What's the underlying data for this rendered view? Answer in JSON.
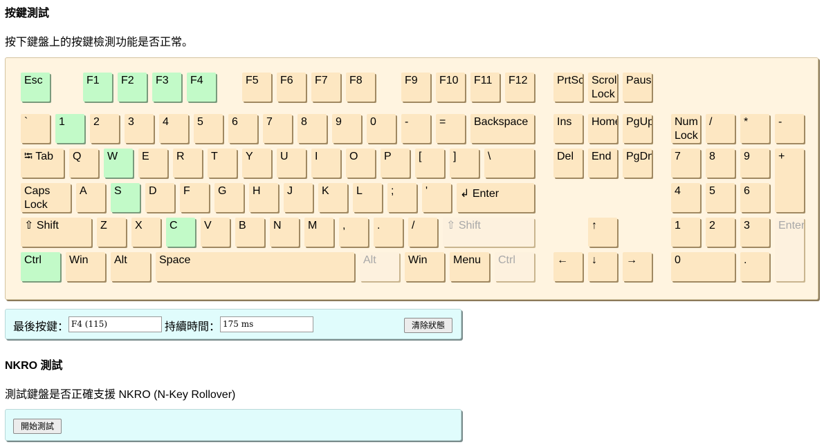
{
  "keytest": {
    "heading": "按鍵測試",
    "desc": "按下鍵盤上的按鍵檢測功能是否正常。",
    "last_key_label": "最後按鍵：",
    "last_key_value": "F4 (115)",
    "duration_label": "持續時間：",
    "duration_value": "175 ms",
    "clear_button": "清除狀態"
  },
  "nkro": {
    "heading": "NKRO 測試",
    "desc": "測試鍵盤是否正確支援 NKRO (N-Key Rollover)",
    "start_button": "開始測試"
  },
  "colors": {
    "key_default": "#fde7c2",
    "key_pressed": "#c2fac8",
    "key_disabled": "#fdf1de",
    "keyboard_bg": "#fff4e0",
    "panel_bg": "#e0fcfc"
  },
  "keys": [
    {
      "id": "esc",
      "label": "Esc",
      "state": "on"
    },
    {
      "id": "f1",
      "label": "F1",
      "state": "on"
    },
    {
      "id": "f2",
      "label": "F2",
      "state": "on"
    },
    {
      "id": "f3",
      "label": "F3",
      "state": "on"
    },
    {
      "id": "f4",
      "label": "F4",
      "state": "on"
    },
    {
      "id": "f5",
      "label": "F5"
    },
    {
      "id": "f6",
      "label": "F6"
    },
    {
      "id": "f7",
      "label": "F7"
    },
    {
      "id": "f8",
      "label": "F8"
    },
    {
      "id": "f9",
      "label": "F9"
    },
    {
      "id": "f10",
      "label": "F10"
    },
    {
      "id": "f11",
      "label": "F11"
    },
    {
      "id": "f12",
      "label": "F12"
    },
    {
      "id": "prtsc",
      "label": "PrtSc"
    },
    {
      "id": "scroll-lock",
      "label": "Scroll\nLock"
    },
    {
      "id": "pause",
      "label": "Pause"
    },
    {
      "id": "backtick",
      "label": "`"
    },
    {
      "id": "digit-1",
      "label": "1",
      "state": "on"
    },
    {
      "id": "digit-2",
      "label": "2"
    },
    {
      "id": "digit-3",
      "label": "3"
    },
    {
      "id": "digit-4",
      "label": "4"
    },
    {
      "id": "digit-5",
      "label": "5"
    },
    {
      "id": "digit-6",
      "label": "6"
    },
    {
      "id": "digit-7",
      "label": "7"
    },
    {
      "id": "digit-8",
      "label": "8"
    },
    {
      "id": "digit-9",
      "label": "9"
    },
    {
      "id": "digit-0",
      "label": "0"
    },
    {
      "id": "minus",
      "label": "-"
    },
    {
      "id": "equal",
      "label": "="
    },
    {
      "id": "backspace",
      "label": "Backspace"
    },
    {
      "id": "insert",
      "label": "Ins"
    },
    {
      "id": "home",
      "label": "Home"
    },
    {
      "id": "pgup",
      "label": "PgUp"
    },
    {
      "id": "numlock",
      "label": "Num\nLock"
    },
    {
      "id": "num-divide",
      "label": "/"
    },
    {
      "id": "num-multiply",
      "label": "*"
    },
    {
      "id": "num-minus",
      "label": "-"
    },
    {
      "id": "tab",
      "label": "⭾ Tab"
    },
    {
      "id": "q",
      "label": "Q"
    },
    {
      "id": "w",
      "label": "W",
      "state": "on"
    },
    {
      "id": "e",
      "label": "E"
    },
    {
      "id": "r",
      "label": "R"
    },
    {
      "id": "t",
      "label": "T"
    },
    {
      "id": "y",
      "label": "Y"
    },
    {
      "id": "u",
      "label": "U"
    },
    {
      "id": "i",
      "label": "I"
    },
    {
      "id": "o",
      "label": "O"
    },
    {
      "id": "p",
      "label": "P"
    },
    {
      "id": "bracket-left",
      "label": "["
    },
    {
      "id": "bracket-right",
      "label": "]"
    },
    {
      "id": "backslash",
      "label": "\\"
    },
    {
      "id": "delete",
      "label": "Del"
    },
    {
      "id": "end",
      "label": "End"
    },
    {
      "id": "pgdn",
      "label": "PgDn"
    },
    {
      "id": "num-7",
      "label": "7"
    },
    {
      "id": "num-8",
      "label": "8"
    },
    {
      "id": "num-9",
      "label": "9"
    },
    {
      "id": "num-plus",
      "label": "+"
    },
    {
      "id": "caps-lock",
      "label": "Caps\nLock"
    },
    {
      "id": "a",
      "label": "A"
    },
    {
      "id": "s",
      "label": "S",
      "state": "on"
    },
    {
      "id": "d",
      "label": "D"
    },
    {
      "id": "f",
      "label": "F"
    },
    {
      "id": "g",
      "label": "G"
    },
    {
      "id": "h",
      "label": "H"
    },
    {
      "id": "j",
      "label": "J"
    },
    {
      "id": "k",
      "label": "K"
    },
    {
      "id": "l",
      "label": "L"
    },
    {
      "id": "semicolon",
      "label": ";"
    },
    {
      "id": "quote",
      "label": "'"
    },
    {
      "id": "enter",
      "label": "↲ Enter"
    },
    {
      "id": "num-4",
      "label": "4"
    },
    {
      "id": "num-5",
      "label": "5"
    },
    {
      "id": "num-6",
      "label": "6"
    },
    {
      "id": "shift-left",
      "label": "⇧ Shift"
    },
    {
      "id": "z",
      "label": "Z"
    },
    {
      "id": "x",
      "label": "X"
    },
    {
      "id": "c",
      "label": "C",
      "state": "on"
    },
    {
      "id": "v",
      "label": "V"
    },
    {
      "id": "b",
      "label": "B"
    },
    {
      "id": "n",
      "label": "N"
    },
    {
      "id": "m",
      "label": "M"
    },
    {
      "id": "comma",
      "label": ","
    },
    {
      "id": "period",
      "label": "."
    },
    {
      "id": "slash",
      "label": "/"
    },
    {
      "id": "shift-right",
      "label": "⇧ Shift",
      "state": "dim"
    },
    {
      "id": "arrow-up",
      "label": "↑"
    },
    {
      "id": "num-1",
      "label": "1"
    },
    {
      "id": "num-2",
      "label": "2"
    },
    {
      "id": "num-3",
      "label": "3"
    },
    {
      "id": "num-enter",
      "label": "Enter",
      "state": "dim"
    },
    {
      "id": "ctrl-left",
      "label": "Ctrl",
      "state": "on"
    },
    {
      "id": "win-left",
      "label": "Win"
    },
    {
      "id": "alt-left",
      "label": "Alt"
    },
    {
      "id": "space",
      "label": "Space"
    },
    {
      "id": "alt-right",
      "label": "Alt",
      "state": "dim"
    },
    {
      "id": "win-right",
      "label": "Win"
    },
    {
      "id": "menu",
      "label": "Menu"
    },
    {
      "id": "ctrl-right",
      "label": "Ctrl",
      "state": "dim"
    },
    {
      "id": "arrow-left",
      "label": "←"
    },
    {
      "id": "arrow-down",
      "label": "↓"
    },
    {
      "id": "arrow-right",
      "label": "→"
    },
    {
      "id": "num-0",
      "label": "0"
    },
    {
      "id": "num-decimal",
      "label": "."
    }
  ]
}
